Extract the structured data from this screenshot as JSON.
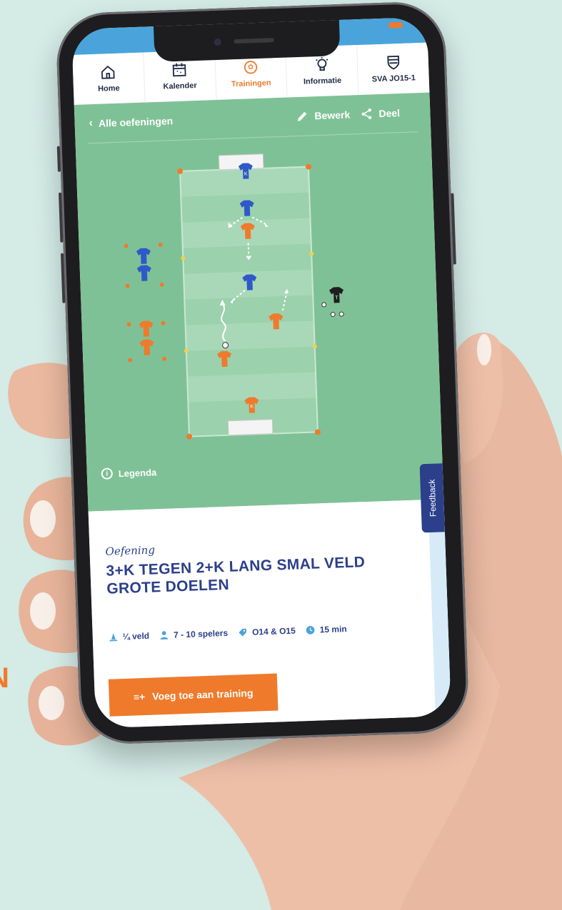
{
  "edge_text": "N",
  "nav": {
    "items": [
      {
        "label": "Home"
      },
      {
        "label": "Kalender"
      },
      {
        "label": "Trainingen"
      },
      {
        "label": "Informatie"
      },
      {
        "label": "SVA JO15-1"
      }
    ],
    "active_index": 2
  },
  "exercise_header": {
    "back_label": "Alle oefeningen",
    "edit_label": "Bewerk",
    "share_label": "Deel"
  },
  "pitch": {
    "keeper_label": "K",
    "trainer_label": "T"
  },
  "legend_label": "Legenda",
  "feedback_label": "Feedback",
  "exercise": {
    "eyebrow": "Oefening",
    "title": "3+K TEGEN 2+K LANG SMAL VELD GROTE DOELEN",
    "meta": {
      "field": "¼ veld",
      "players": "7 - 10 spelers",
      "age": "O14 & O15",
      "duration": "15 min"
    },
    "cta_label": "Voeg toe aan training"
  },
  "colors": {
    "accent": "#ef7a2c",
    "navy": "#2b3f8b",
    "pitch": "#7fc196",
    "blue_team": "#2f58c9",
    "orange_team": "#ef7a2c"
  },
  "icons": {
    "home": "home-icon",
    "calendar": "calendar-icon",
    "ball": "soccer-ball-icon",
    "bulb": "lightbulb-icon",
    "shield": "shield-icon"
  }
}
